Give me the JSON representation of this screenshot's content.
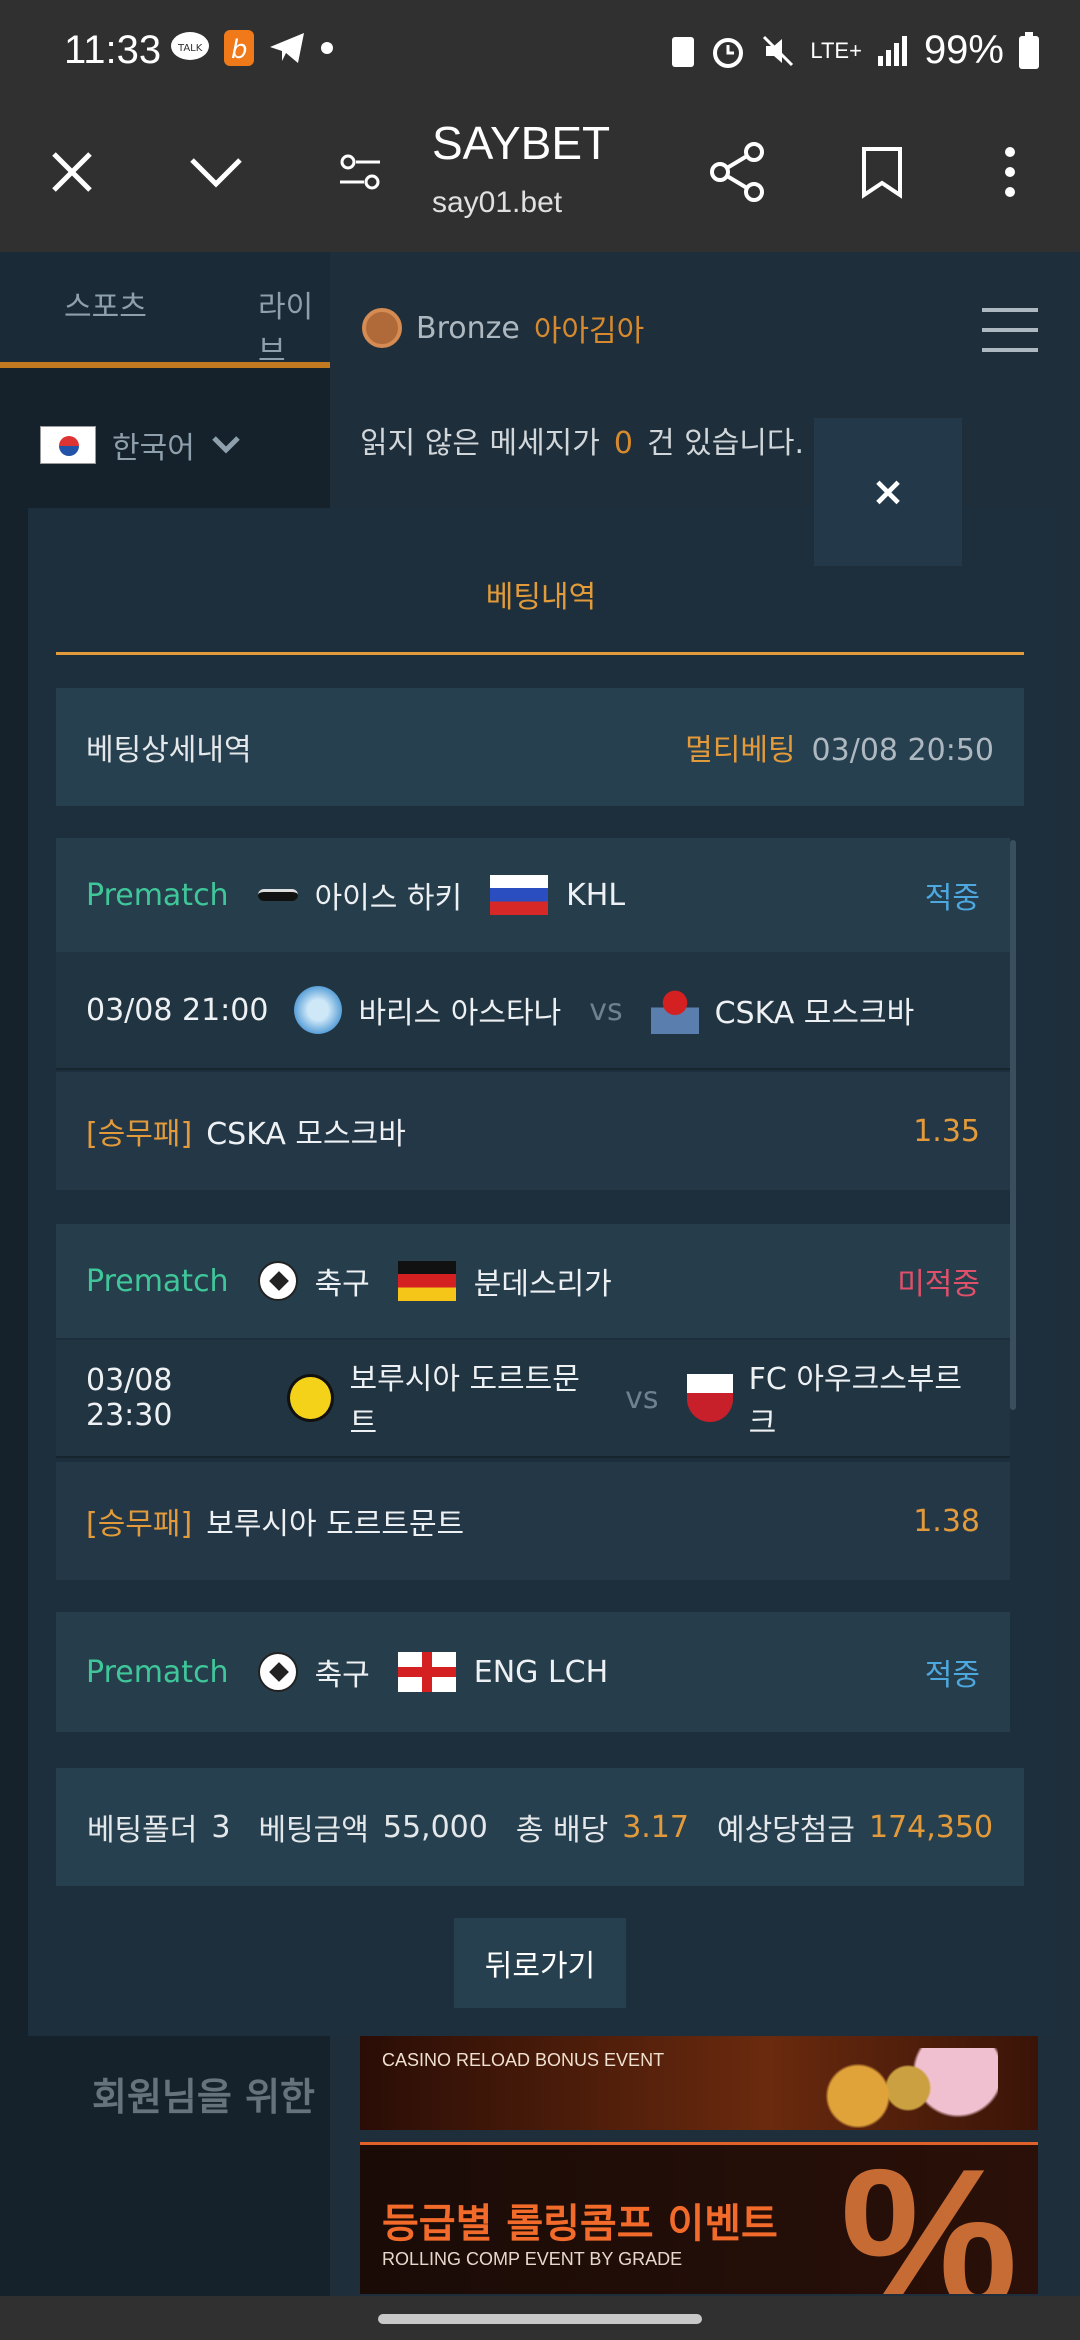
{
  "status_bar": {
    "time": "11:33",
    "battery": "99%",
    "network": "LTE+"
  },
  "browser": {
    "title": "SAYBET",
    "url": "say01.bet"
  },
  "site": {
    "tabs": [
      "스포츠",
      "라이브"
    ],
    "language": "한국어",
    "rank_level": "Bronze",
    "nickname": "아아김아",
    "message_prefix": "읽지 않은 메세지가",
    "message_count": "0",
    "message_suffix": "건 있습니다.",
    "welcome_text": "회원님을 위한",
    "banner1_text": "CASINO RELOAD BONUS EVENT",
    "banner2_title": "등급별 롤링콤프 이벤트",
    "banner2_sub": "ROLLING COMP EVENT BY GRADE",
    "banner2_symbol": "%"
  },
  "modal": {
    "close_label": "×",
    "title": "베팅내역",
    "detail_label": "베팅상세내역",
    "bet_type": "멀티베팅",
    "bet_datetime": "03/08 20:50",
    "bets": [
      {
        "mode": "Prematch",
        "sport": "아이스 하키",
        "league": "KHL",
        "result": "적중",
        "match_time": "03/08 21:00",
        "home": "바리스 아스타나",
        "vs": "vs",
        "away": "CSKA 모스크바",
        "market": "[승무패]",
        "pick": "CSKA 모스크바",
        "odds": "1.35"
      },
      {
        "mode": "Prematch",
        "sport": "축구",
        "league": "분데스리가",
        "result": "미적중",
        "match_time": "03/08 23:30",
        "home": "보루시아 도르트문트",
        "vs": "vs",
        "away": "FC 아우크스부르크",
        "market": "[승무패]",
        "pick": "보루시아 도르트문트",
        "odds": "1.38"
      },
      {
        "mode": "Prematch",
        "sport": "축구",
        "league": "ENG LCH",
        "result": "적중"
      }
    ],
    "summary": {
      "folder_label": "베팅폴더",
      "folder_value": "3",
      "amount_label": "베팅금액",
      "amount_value": "55,000",
      "odds_label": "총 배당",
      "odds_value": "3.17",
      "payout_label": "예상당첨금",
      "payout_value": "174,350"
    },
    "back_label": "뒤로가기"
  },
  "colors": {
    "accent": "#e29a3a",
    "prematch": "#3fc79a",
    "win": "#4ea8e0",
    "lose": "#e0506a"
  }
}
